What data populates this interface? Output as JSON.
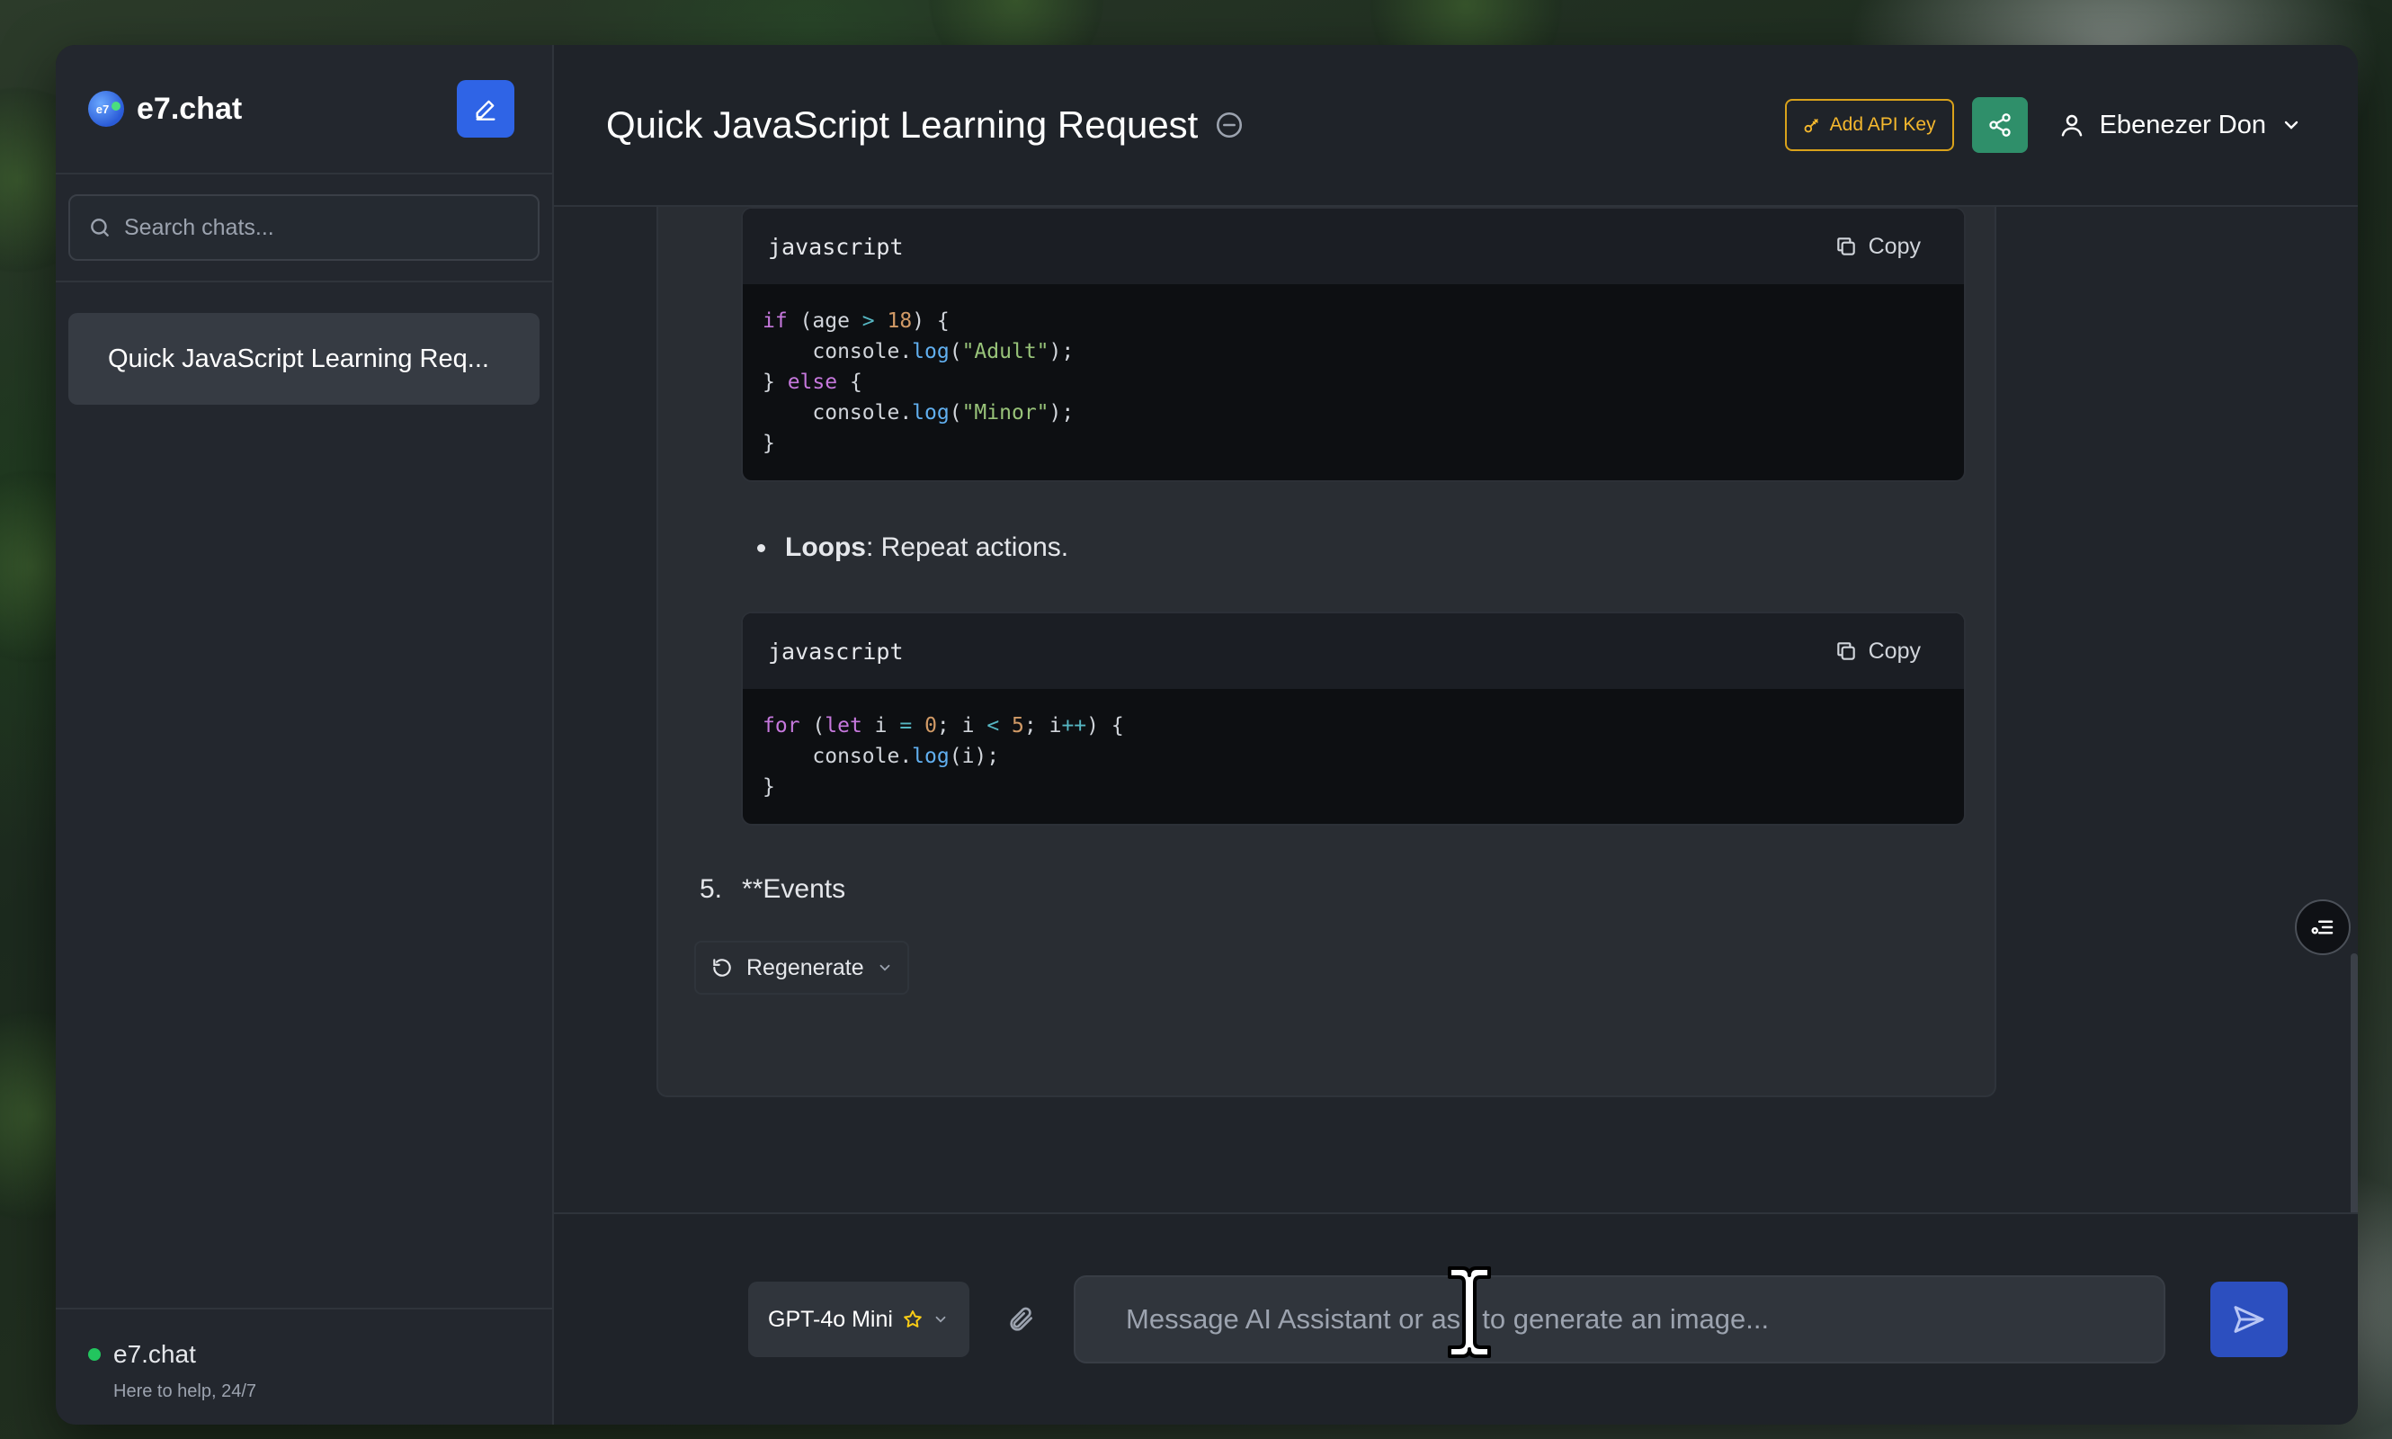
{
  "sidebar": {
    "brand_name": "e7.chat",
    "logo_text": "e7",
    "search_placeholder": "Search chats...",
    "chats": [
      {
        "label": "Quick JavaScript Learning Req..."
      }
    ],
    "footer": {
      "name": "e7.chat",
      "tagline": "Here to help, 24/7"
    }
  },
  "header": {
    "title": "Quick JavaScript Learning Request",
    "add_api_key_label": "Add API Key",
    "user_name": "Ebenezer Don"
  },
  "message": {
    "code_blocks": [
      {
        "language": "javascript",
        "copy_label": "Copy"
      },
      {
        "language": "javascript",
        "copy_label": "Copy"
      }
    ],
    "bullet": {
      "bold": "Loops",
      "text": ": Repeat actions."
    },
    "numbered": {
      "number": "5.",
      "text": "**Events"
    },
    "regenerate_label": "Regenerate"
  },
  "composer": {
    "model_label": "GPT-4o Mini",
    "placeholder": "Message AI Assistant or ask to generate an image..."
  },
  "colors": {
    "accent_blue": "#2f64e6",
    "share_green": "#2f8f6a",
    "api_key_gold": "#d9a21b",
    "status_green": "#22c55e"
  },
  "icons": {
    "new_chat": "edit-pencil-icon",
    "search": "search-icon",
    "title_action": "minus-circle-icon",
    "api_key": "key-icon",
    "share": "share-icon",
    "user": "user-icon",
    "user_menu": "chevron-down-icon",
    "copy": "copy-icon",
    "regenerate": "refresh-icon",
    "outline": "list-icon",
    "model_favorite": "star-icon",
    "attach": "paperclip-icon",
    "send": "send-icon"
  }
}
